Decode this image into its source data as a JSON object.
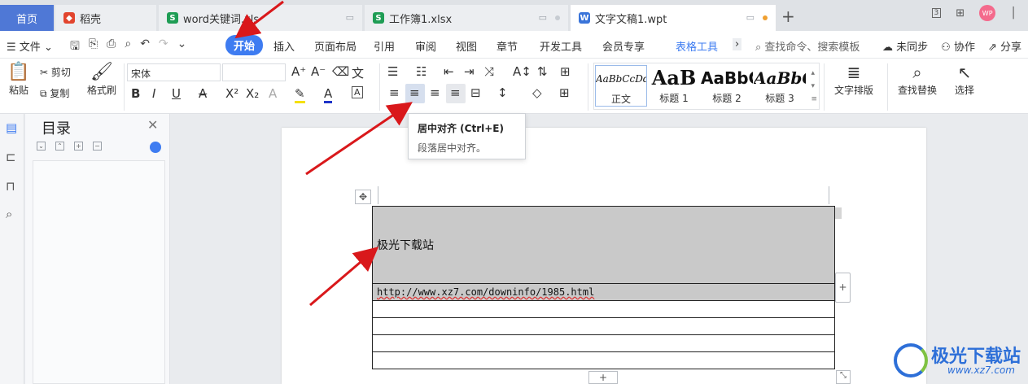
{
  "tabs": {
    "home": "首页",
    "t1": "稻壳",
    "t2": "word关键词.xls",
    "t3": "工作簿1.xlsx",
    "t4": "文字文稿1.wpt",
    "new_tab": "+"
  },
  "window": {
    "avatar": "WP",
    "layout_badge": "3"
  },
  "menubar": {
    "file": "文件",
    "items": [
      "开始",
      "插入",
      "页面布局",
      "引用",
      "审阅",
      "视图",
      "章节",
      "开发工具",
      "会员专享",
      "表格工具"
    ],
    "search": "查找命令、搜索模板",
    "sync": "未同步",
    "collab": "协作",
    "share": "分享"
  },
  "ribbon": {
    "paste": "粘贴",
    "cut": "剪切",
    "copy": "复制",
    "format_painter": "格式刷",
    "font_name": "宋体",
    "font_size": "",
    "styles": [
      {
        "preview": "AaBbCcDd",
        "caption": "正文"
      },
      {
        "preview": "AaB",
        "caption": "标题 1"
      },
      {
        "preview": "AaBbC",
        "caption": "标题 2"
      },
      {
        "preview": "AaBbC",
        "caption": "标题 3"
      }
    ],
    "text_layout": "文字排版",
    "find_replace": "查找替换",
    "select": "选择"
  },
  "tooltip": {
    "title": "居中对齐 (Ctrl+E)",
    "desc": "段落居中对齐。"
  },
  "toc": {
    "title": "目录"
  },
  "document": {
    "cell_title": "极光下载站",
    "cell_url": "http://www.xz7.com/downinfo/1985.html"
  },
  "watermark": {
    "name": "极光下载站",
    "url": "www.xz7.com"
  },
  "colors": {
    "accent": "#3e7cf1",
    "home_tab": "#4f78d6",
    "arrow": "#d9181b",
    "cell_fill": "#c9c9c9"
  }
}
